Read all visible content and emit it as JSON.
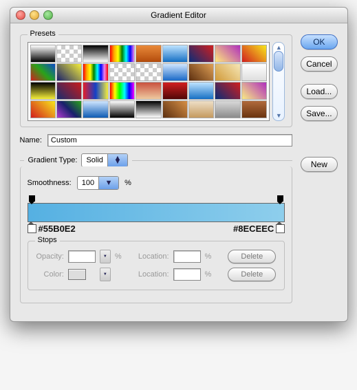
{
  "title": "Gradient Editor",
  "buttons": {
    "ok": "OK",
    "cancel": "Cancel",
    "load": "Load...",
    "save": "Save...",
    "new": "New"
  },
  "presets": {
    "label": "Presets",
    "swatches": [
      "linear-gradient(#fff,#000)",
      "check",
      "linear-gradient(#000,#fff)",
      "linear-gradient(90deg,red,orange,yellow,green,cyan,blue,violet)",
      "linear-gradient(#e98a3a,#b34b0c)",
      "linear-gradient(#bde3ff,#1570c4)",
      "linear-gradient(45deg,#0a2c78,#d11e1e)",
      "linear-gradient(45deg,#ffe97a,#b02fbc)",
      "linear-gradient(45deg,#d11e1e,#f8e71c)",
      "linear-gradient(45deg,#d11e1e,#29a31a,#0b49c9)",
      "linear-gradient(45deg,#19206b,#f6ef3a)",
      "linear-gradient(90deg,red,orange,yellow,green,cyan,blue,violet,red)",
      "check-stripe",
      "check",
      "linear-gradient(#cfe6ff,#1a69c7)",
      "linear-gradient(45deg,#5c2f10,#e0a055)",
      "linear-gradient(45deg,#d19a3a,#f6e7b6)",
      "linear-gradient(#fff,#dedede)",
      "linear-gradient(#000,#f6ef3a)",
      "linear-gradient(45deg,#1a2c6f,#c81b1b)",
      "linear-gradient(90deg,#e6202a,#1340c7,#f6ef3a)",
      "linear-gradient(90deg,red,yellow,lime,cyan,blue,magenta)",
      "linear-gradient(#c9513f,#eecaa0)",
      "linear-gradient(#d11e1e,#520707)",
      "linear-gradient(#bde3ff,#1570c4)",
      "linear-gradient(45deg,#0a2c78,#d11e1e)",
      "linear-gradient(45deg,#f9ec83,#b02fbc)",
      "linear-gradient(45deg,#d11e1e,#f8e71c)",
      "linear-gradient(45deg,#b03bd1,#19206b,#29a31a)",
      "linear-gradient(#cfe6ff,#0e5bb3)",
      "linear-gradient(#fff,#000)",
      "linear-gradient(#000,#fff)",
      "linear-gradient(45deg,#5c2f10,#d68f45)",
      "linear-gradient(#eedfc7,#c59a5f)",
      "linear-gradient(#d9d9d9,#8b8b8b)",
      "linear-gradient(#b06a3c,#6a3410)"
    ]
  },
  "name": {
    "label": "Name:",
    "value": "Custom"
  },
  "gradientType": {
    "label": "Gradient Type:",
    "value": "Solid"
  },
  "smoothness": {
    "label": "Smoothness:",
    "value": "100",
    "unit": "%"
  },
  "gradient": {
    "left_hex": "#55B0E2",
    "right_hex": "#8ECEEC"
  },
  "stops": {
    "label": "Stops",
    "opacity": {
      "label": "Opacity:",
      "value": "",
      "unit": "%"
    },
    "color": {
      "label": "Color:"
    },
    "location": {
      "label": "Location:",
      "value": "",
      "unit": "%"
    },
    "delete": "Delete"
  }
}
